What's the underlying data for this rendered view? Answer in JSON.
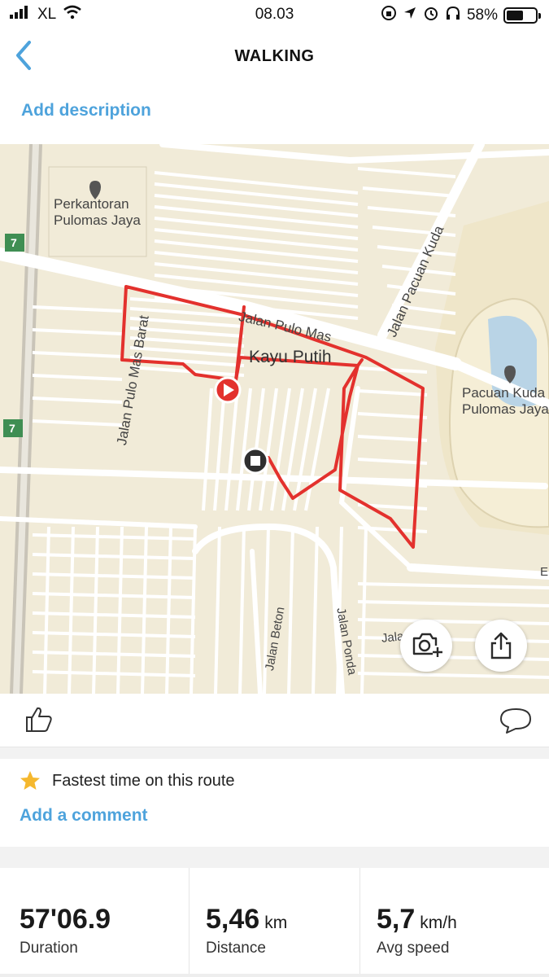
{
  "status": {
    "carrier": "XL",
    "time": "08.03",
    "battery_percent_text": "58%",
    "battery_level": 0.58
  },
  "header": {
    "title": "WALKING",
    "back_icon": "chevron-left-icon"
  },
  "description": {
    "add_label": "Add description"
  },
  "map": {
    "labels": {
      "perkantoran_line1": "Perkantoran",
      "perkantoran_line2": "Pulomas Jaya",
      "road_7_a": "7",
      "road_7_b": "7",
      "jalan_pulo_mas": "Jalan Pulo Mas",
      "jalan_pacuan_kuda": "Jalan Pacuan Kuda",
      "jalan_pulo_mas_barat": "Jalan Pulo Mas Barat",
      "kayu_putih": "Kayu Putih",
      "pacuan_line1": "Pacuan Kuda",
      "pacuan_line2": "Pulomas Jaya",
      "jalan_beton": "Jalan Beton",
      "jalan_ponda": "Jalan Ponda",
      "jalan_partial": "Jalan    ur",
      "edge_e": "E"
    },
    "route_color": "#e3312d",
    "camera_icon": "camera-add-icon",
    "share_icon": "share-icon"
  },
  "social": {
    "like_icon": "thumbs-up-icon",
    "comment_icon": "comment-icon"
  },
  "achievement": {
    "icon": "star-icon",
    "text": "Fastest time on this route"
  },
  "comments": {
    "add_label": "Add a comment"
  },
  "stats": [
    {
      "value": "57'06.9",
      "unit": "",
      "label": "Duration"
    },
    {
      "value": "5,46",
      "unit": "km",
      "label": "Distance"
    },
    {
      "value": "5,7",
      "unit": "km/h",
      "label": "Avg speed"
    }
  ]
}
